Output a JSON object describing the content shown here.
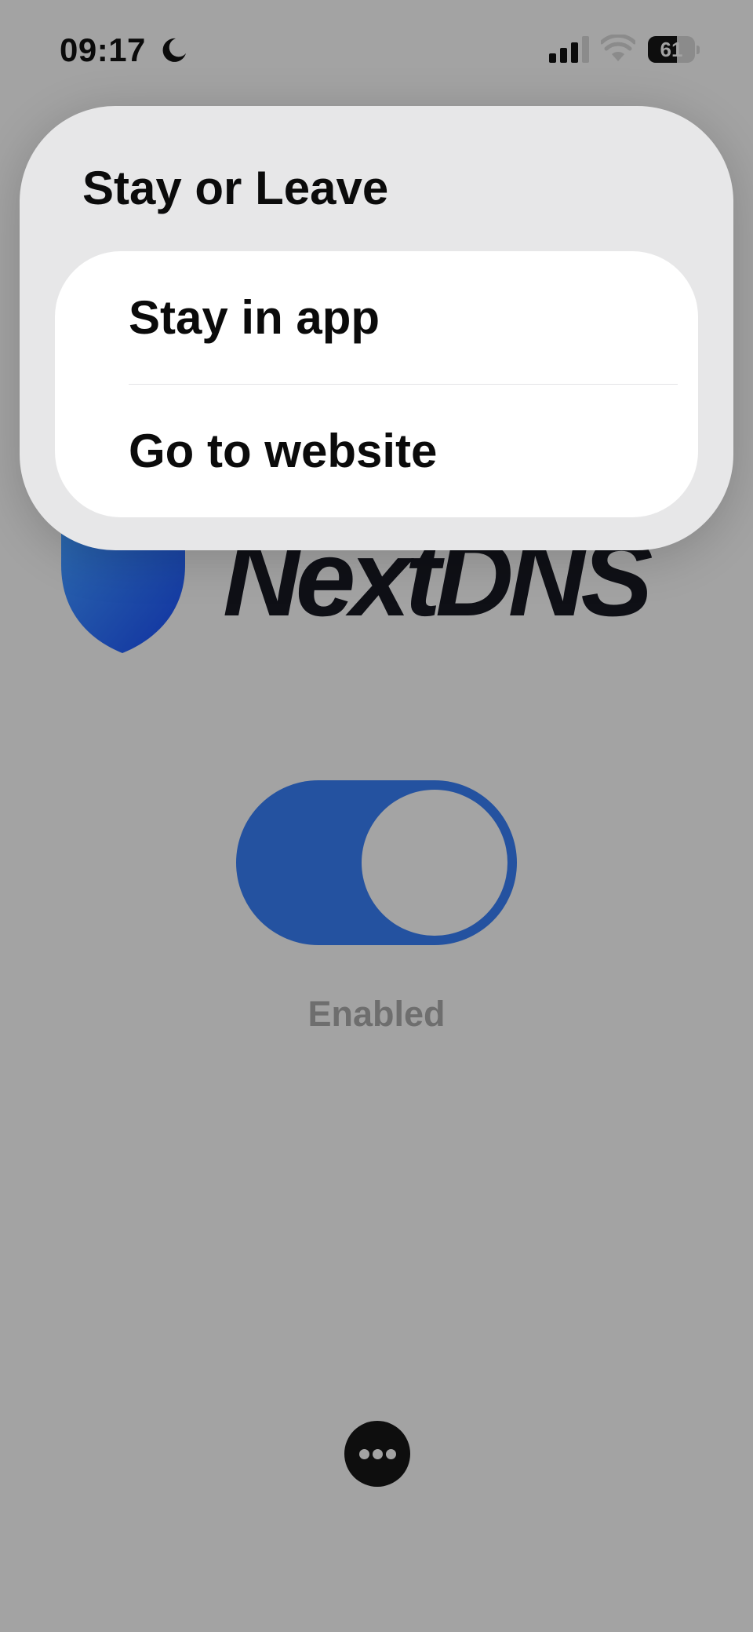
{
  "status_bar": {
    "time": "09:17",
    "battery_level": "61",
    "icons": [
      "moon-icon",
      "signal-icon",
      "wifi-icon",
      "battery-icon"
    ]
  },
  "app": {
    "brand_name": "NextDNS",
    "toggle_state_label": "Enabled",
    "toggle_on": true,
    "more_icon": "ellipsis-icon",
    "colors": {
      "accent": "#2452a0",
      "background": "#a3a3a3",
      "shield_gradient": [
        "#2f6fb0",
        "#1030a0"
      ]
    }
  },
  "menu": {
    "title": "Stay or Leave",
    "options": [
      {
        "label": "Stay in app"
      },
      {
        "label": "Go to website"
      }
    ]
  }
}
